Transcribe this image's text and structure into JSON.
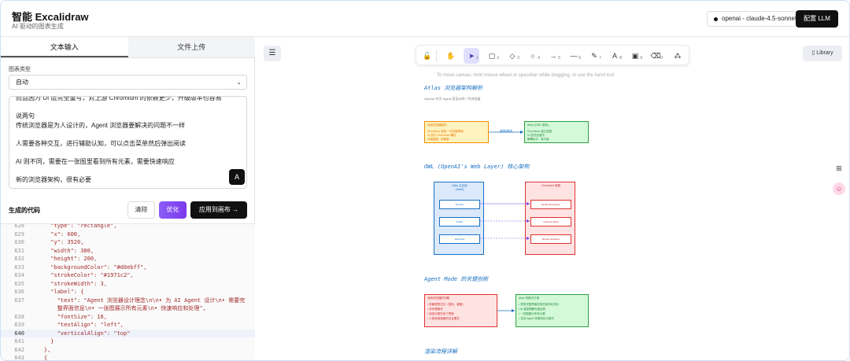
{
  "header": {
    "title": "智能 Excalidraw",
    "subtitle": "AI 驱动的图表生成",
    "model": "openai - claude-4.5-sonnet",
    "config_button": "配置 LLM"
  },
  "left": {
    "tabs": [
      {
        "label": "文本输入"
      },
      {
        "label": "文件上传"
      }
    ],
    "chart_type_label": "图表类型",
    "chart_type_value": "自动",
    "textarea_lines": [
      "而且因为 UI 层完全重写，对上游 Chromium 的依赖更少，升级版本也容易",
      "说两句",
      "传统浏览器是为人设计的，Agent 浏览器要解决的问题不一样",
      "人需要各种交互，进行辅助认知，可以点击菜单然后弹出阅读",
      "AI 则不同，需要在一张图里看到所有元素，需要快速响应",
      "新的浏览器架构，很有必要"
    ],
    "generated_code_label": "生成的代码",
    "clear_button": "清除",
    "optimize_button": "优化",
    "apply_button": "应用到画布",
    "code_lines": [
      {
        "n": "628",
        "t": "      \"type\": \"rectangle\","
      },
      {
        "n": "629",
        "t": "      \"x\": 600,"
      },
      {
        "n": "630",
        "t": "      \"y\": 3520,"
      },
      {
        "n": "631",
        "t": "      \"width\": 380,"
      },
      {
        "n": "632",
        "t": "      \"height\": 200,"
      },
      {
        "n": "633",
        "t": "      \"backgroundColor\": \"#d0ebff\","
      },
      {
        "n": "634",
        "t": "      \"strokeColor\": \"#1971c2\","
      },
      {
        "n": "635",
        "t": "      \"strokeWidth\": 3,"
      },
      {
        "n": "636",
        "t": "      \"label\": {"
      },
      {
        "n": "637",
        "t": "        \"text\": \"Agent 浏览器设计理念\\n\\n• 为 AI Agent 设计\\n• 需要完"
      },
      {
        "n": "",
        "t": "        整界面信息\\n• 一张图展示所有元素\\n• 快速响应和处理\","
      },
      {
        "n": "638",
        "t": "        \"fontSize\": 16,"
      },
      {
        "n": "639",
        "t": "        \"textAlign\": \"left\","
      },
      {
        "n": "640",
        "t": "        \"verticalAlign\": \"top\""
      },
      {
        "n": "641",
        "t": "      }"
      },
      {
        "n": "642",
        "t": "    },"
      },
      {
        "n": "643",
        "t": "    {"
      }
    ]
  },
  "canvas": {
    "library_label": "Library",
    "hint": "To move canvas, hold mouse wheel or spacebar while dragging, or use the hand tool",
    "tools": [
      {
        "name": "lock-icon",
        "glyph": "🔓"
      },
      {
        "name": "hand-icon",
        "glyph": "✋"
      },
      {
        "name": "selection-icon",
        "glyph": "➤",
        "num": "1"
      },
      {
        "name": "rectangle-icon",
        "glyph": "▢",
        "num": "2"
      },
      {
        "name": "diamond-icon",
        "glyph": "◇",
        "num": "3"
      },
      {
        "name": "ellipse-icon",
        "glyph": "○",
        "num": "4"
      },
      {
        "name": "arrow-icon",
        "glyph": "→",
        "num": "5"
      },
      {
        "name": "line-icon",
        "glyph": "—",
        "num": "6"
      },
      {
        "name": "pencil-icon",
        "glyph": "✎",
        "num": "7"
      },
      {
        "name": "text-icon",
        "glyph": "A",
        "num": "8"
      },
      {
        "name": "image-icon",
        "glyph": "▣",
        "num": "9"
      },
      {
        "name": "eraser-icon",
        "glyph": "⌫",
        "num": "0"
      },
      {
        "name": "extra-tools-icon",
        "glyph": "⁂"
      }
    ],
    "diagram": {
      "title1": "Atlas 浏览器架构解析",
      "subtitle1": "OpenAI 专为 Agent 而设计的一代浏览器",
      "box_y1": "传统浏览器架构",
      "box_y1_lines": [
        "Chromium 渲染 + 浏览器界面",
        "UI 层与 Chromium 耦合",
        "升级困难 · 依赖重"
      ],
      "box_g1": "Atlas (OWL 架构)",
      "box_g1_lines": [
        "Chromium 独立进程",
        "UI 层完全重写",
        "解耦设计 · 易升级"
      ],
      "arrow_label1": "架构演进",
      "title2": "OWL (OpenAI's Web Layer) 核心架构",
      "box_b": "Atlas 主应用",
      "box_b_sub": "(Swift)",
      "box_r": "Chromium 进程",
      "b_items": [
        "Session",
        "Profile",
        "WebView"
      ],
      "r_items": [
        "Rendering Engine",
        "Network Stack",
        "Render Modules"
      ],
      "title3": "Agent Mode 的关键创新",
      "box_r2": "传统浏览器的问题",
      "box_r2_lines": [
        "• 依赖视觉交互（鼠标、键盘）",
        "• 多步骤操作",
        "• 信息分散在多个界面",
        "• 人类阅读速度的交互模式"
      ],
      "box_g2": "Atlas 的解决方案",
      "box_g2_lines": [
        "• 提供完整界面信息的结构化表示",
        "• AI 直接理解页面结构",
        "• 一张图展示所有元素",
        "• 支持 Agent 快速响应与操作"
      ],
      "title4": "渲染流程详解"
    }
  },
  "colors": {
    "accent": "#111111",
    "optimize": "#8b5cf6",
    "selection": "#e0dfff",
    "diagram_blue": "#1971c2",
    "diagram_red": "#e03131",
    "diagram_green": "#2f9e44",
    "diagram_yellow": "#f08c00"
  }
}
